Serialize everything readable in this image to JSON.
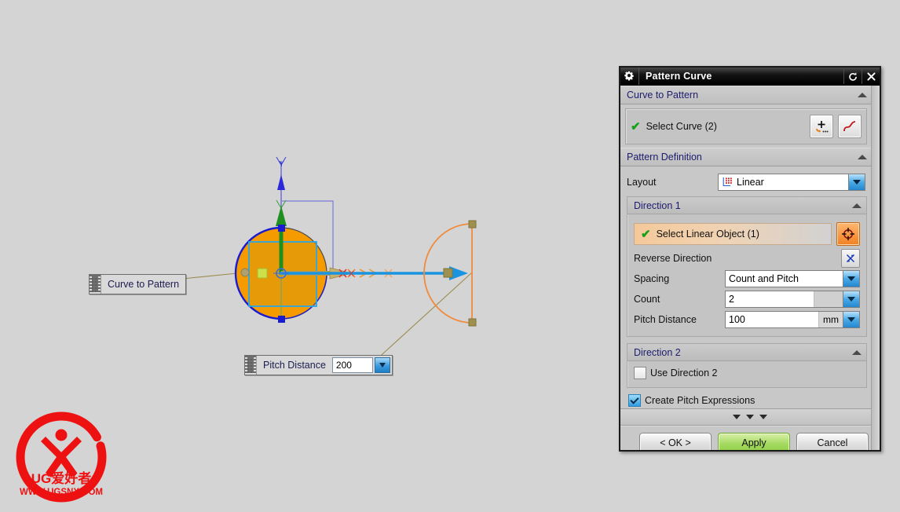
{
  "viewport": {
    "callouts": [
      {
        "name": "curve-to-pattern",
        "label": "Curve to Pattern"
      },
      {
        "name": "pitch-distance",
        "label": "Pitch Distance",
        "value": "200"
      }
    ],
    "axis_labels": {
      "y": "Y",
      "x": "X"
    },
    "colors": {
      "background": "#d4d4d4",
      "circle_fill": "#f59b00",
      "circle_edge": "#1a1ad0",
      "square_edge": "#2aa7e8",
      "arc": "#f08a3c",
      "direction_arrow": "#1a94e0",
      "y_axis": "#1f8f1f",
      "x_axis": "#b49a52",
      "handle": "#cde04a"
    }
  },
  "watermark": {
    "line1": "UG爱好者",
    "line2": "WWW.UGSNX.COM",
    "color": "#ee1111"
  },
  "dialog": {
    "title": "Pattern Curve",
    "titlebar_icons": {
      "gear": "gear-icon",
      "reset": "reset-icon",
      "close": "close-icon"
    },
    "sections": {
      "curve_to_pattern": {
        "header": "Curve to Pattern",
        "select_curve_label": "Select Curve (2)",
        "buttons": {
          "add": "add-selection-icon",
          "curve": "curve-rule-icon"
        }
      },
      "pattern_definition": {
        "header": "Pattern Definition",
        "layout_label": "Layout",
        "layout_value": "Linear",
        "direction1": {
          "header": "Direction 1",
          "select_linear_object": "Select Linear Object (1)",
          "reverse_direction_label": "Reverse Direction",
          "spacing_label": "Spacing",
          "spacing_value": "Count and Pitch",
          "count_label": "Count",
          "count_value": "2",
          "pitch_label": "Pitch Distance",
          "pitch_value": "100",
          "pitch_unit": "mm"
        },
        "direction2": {
          "header": "Direction 2",
          "use_direction2_label": "Use Direction 2",
          "use_direction2_checked": false
        },
        "create_pitch_expressions_label": "Create Pitch Expressions",
        "create_pitch_expressions_checked": true
      }
    },
    "footer": {
      "ok": "< OK >",
      "apply": "Apply",
      "cancel": "Cancel"
    }
  }
}
